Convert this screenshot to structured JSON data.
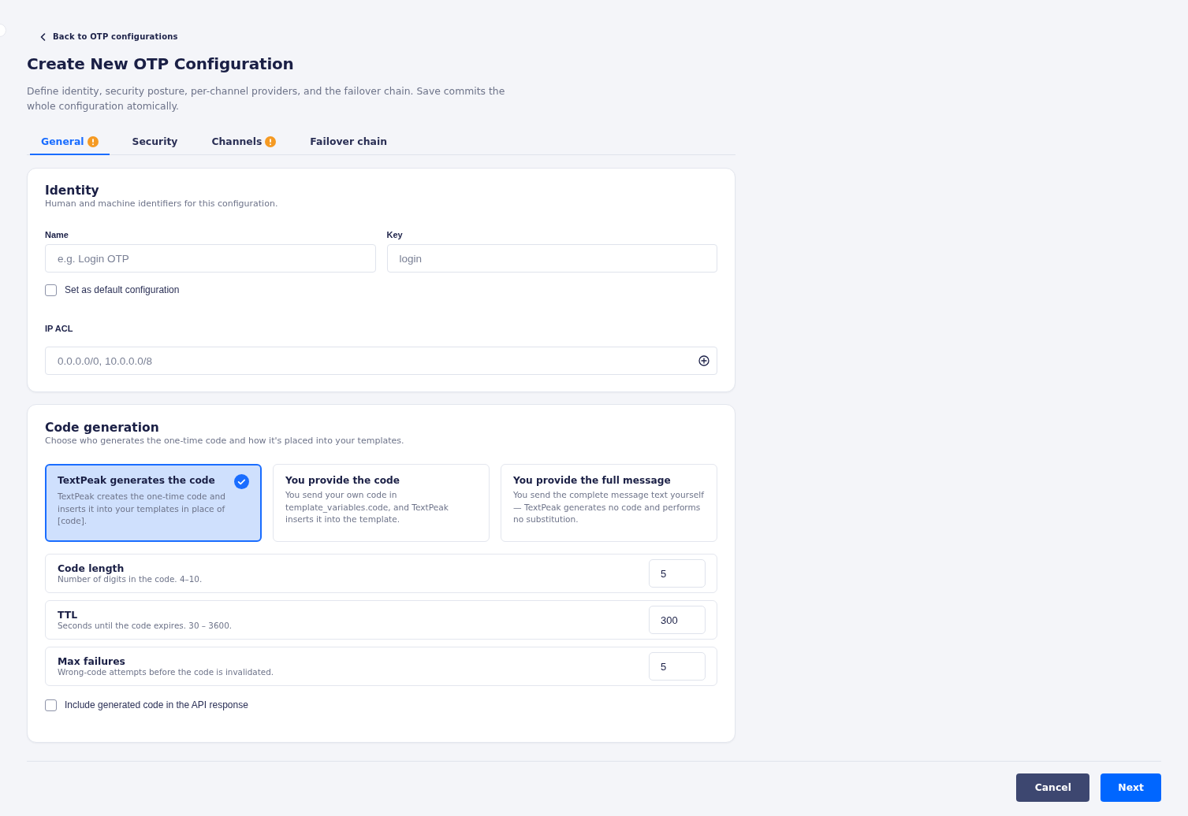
{
  "back_link": {
    "label": "Back to OTP configurations"
  },
  "page": {
    "title": "Create New OTP Configuration",
    "description": "Define identity, security posture, per-channel providers, and the failover chain. Save commits the whole configuration atomically."
  },
  "tabs": [
    {
      "label": "General",
      "selected": true,
      "warning": true
    },
    {
      "label": "Security",
      "selected": false,
      "warning": false
    },
    {
      "label": "Channels",
      "selected": false,
      "warning": true
    },
    {
      "label": "Failover chain",
      "selected": false,
      "warning": false
    }
  ],
  "identity": {
    "title": "Identity",
    "subtitle": "Human and machine identifiers for this configuration.",
    "fields": [
      {
        "label": "Name",
        "placeholder": "e.g. Login OTP"
      },
      {
        "label": "Key",
        "placeholder": "login"
      }
    ],
    "default_checkbox": {
      "label": "Set as default configuration",
      "checked": false
    },
    "ip_acl": {
      "label": "IP ACL",
      "placeholder": "0.0.0.0/0, 10.0.0.0/8"
    }
  },
  "code_generation": {
    "title": "Code generation",
    "subtitle": "Choose who generates the one-time code and how it's placed into your templates.",
    "options": [
      {
        "title": "TextPeak generates the code",
        "description": "TextPeak creates the one-time code and inserts it into your templates in place of [code].",
        "selected": true
      },
      {
        "title": "You provide the code",
        "description": "You send your own code in template_variables.code, and TextPeak inserts it into the template.",
        "selected": false
      },
      {
        "title": "You provide the full message",
        "description": "You send the complete message text yourself — TextPeak generates no code and performs no substitution.",
        "selected": false
      }
    ],
    "settings": [
      {
        "label": "Code length",
        "hint": "Number of digits in the code. 4–10.",
        "value": "5"
      },
      {
        "label": "TTL",
        "hint": "Seconds until the code expires. 30 – 3600.",
        "value": "300"
      },
      {
        "label": "Max failures",
        "hint": "Wrong-code attempts before the code is invalidated.",
        "value": "5"
      }
    ],
    "include_checkbox": {
      "label": "Include generated code in the API response",
      "checked": false
    }
  },
  "footer": {
    "buttons": [
      {
        "label": "Cancel",
        "kind": "secondary"
      },
      {
        "label": "Next",
        "kind": "primary"
      }
    ]
  }
}
